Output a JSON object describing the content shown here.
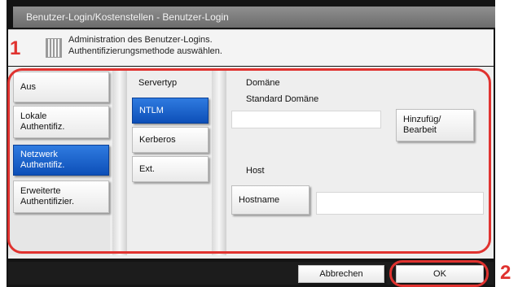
{
  "window": {
    "title": "Benutzer-Login/Kostenstellen - Benutzer-Login"
  },
  "info": {
    "line1": "Administration des Benutzer-Logins.",
    "line2": "Authentifizierungsmethode auswählen."
  },
  "auth_methods": [
    {
      "label": "Aus",
      "selected": false
    },
    {
      "label": "Lokale\nAuthentifiz.",
      "selected": false
    },
    {
      "label": "Netzwerk\nAuthentifiz.",
      "selected": true
    },
    {
      "label": "Erweiterte\nAuthentifizier.",
      "selected": false
    }
  ],
  "server_type": {
    "heading": "Servertyp",
    "options": [
      {
        "label": "NTLM",
        "selected": true
      },
      {
        "label": "Kerberos",
        "selected": false
      },
      {
        "label": "Ext.",
        "selected": false
      }
    ]
  },
  "domain": {
    "heading": "Domäne",
    "standard_label": "Standard Domäne",
    "value": "",
    "add_edit_button": "Hinzufüg/\nBearbeit"
  },
  "host": {
    "heading": "Host",
    "hostname_button": "Hostname",
    "hostname_value": ""
  },
  "footer": {
    "cancel_label": "Abbrechen",
    "ok_label": "OK"
  },
  "markers": {
    "one": "1",
    "two": "2"
  },
  "colors": {
    "selected": "#1a5fd0",
    "callout": "#e0322f"
  }
}
